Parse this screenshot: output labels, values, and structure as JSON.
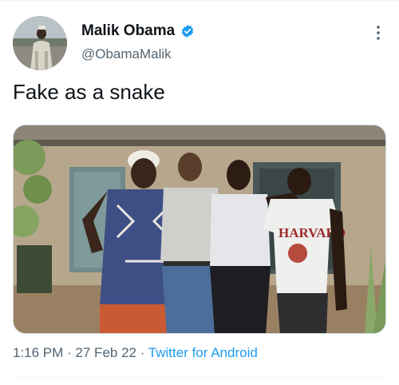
{
  "author": {
    "display_name": "Malik Obama",
    "handle": "@ObamaMalik",
    "verified": true,
    "avatar_icon": "profile-photo"
  },
  "tweet": {
    "text": "Fake as a snake",
    "media_alt": "photo-four-men-standing-outside-house",
    "shirt_text": "HARVARD"
  },
  "meta": {
    "time": "1:16 PM",
    "separator": " · ",
    "date": "27 Feb 22",
    "source": "Twitter for Android"
  },
  "colors": {
    "accent": "#1d9bf0",
    "text_primary": "#0f1419",
    "text_secondary": "#536471",
    "divider": "#eff3f4"
  },
  "icons": {
    "verified": "verified-badge-icon",
    "more": "more-options-icon"
  }
}
